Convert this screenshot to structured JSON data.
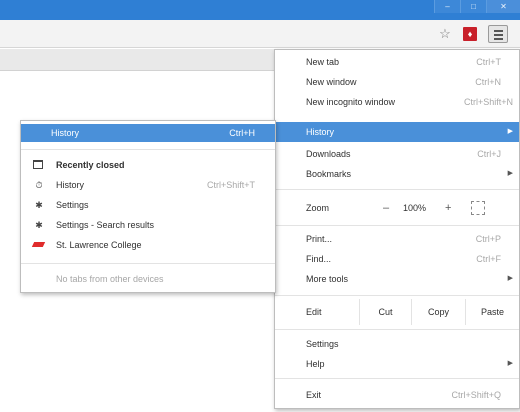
{
  "window": {
    "caption_buttons": [
      "–",
      "□",
      "✕"
    ]
  },
  "toolbar": {
    "icons": [
      "star-icon",
      "pdf-icon",
      "menu-icon"
    ],
    "pdf_glyph": "♦"
  },
  "main_menu": {
    "new_tab": {
      "label": "New tab",
      "shortcut": "Ctrl+T"
    },
    "new_window": {
      "label": "New window",
      "shortcut": "Ctrl+N"
    },
    "new_incognito": {
      "label": "New incognito window",
      "shortcut": "Ctrl+Shift+N"
    },
    "history": {
      "label": "History"
    },
    "downloads": {
      "label": "Downloads",
      "shortcut": "Ctrl+J"
    },
    "bookmarks": {
      "label": "Bookmarks"
    },
    "zoom": {
      "label": "Zoom",
      "minus": "–",
      "value": "100%",
      "plus": "+"
    },
    "print": {
      "label": "Print...",
      "shortcut": "Ctrl+P"
    },
    "find": {
      "label": "Find...",
      "shortcut": "Ctrl+F"
    },
    "more_tools": {
      "label": "More tools"
    },
    "edit": {
      "label": "Edit",
      "cut": "Cut",
      "copy": "Copy",
      "paste": "Paste"
    },
    "settings": {
      "label": "Settings"
    },
    "help": {
      "label": "Help"
    },
    "exit": {
      "label": "Exit",
      "shortcut": "Ctrl+Shift+Q"
    },
    "submenu_arrow": "▶"
  },
  "history_submenu": {
    "history": {
      "label": "History",
      "shortcut": "Ctrl+H"
    },
    "recently_closed": "Recently closed",
    "items": [
      {
        "label": "History",
        "shortcut": "Ctrl+Shift+T",
        "icon": "history-clock-icon"
      },
      {
        "label": "Settings",
        "shortcut": "",
        "icon": "settings-gear-icon"
      },
      {
        "label": "Settings - Search results",
        "shortcut": "",
        "icon": "settings-gear-icon"
      },
      {
        "label": "St. Lawrence College",
        "shortcut": "",
        "icon": "st-lawrence-favicon-icon"
      }
    ],
    "no_tabs": "No tabs from other devices"
  },
  "colors": {
    "highlight": "#4a90d9",
    "titlebar": "#2f7fd4",
    "pdf_red": "#c8202a"
  }
}
